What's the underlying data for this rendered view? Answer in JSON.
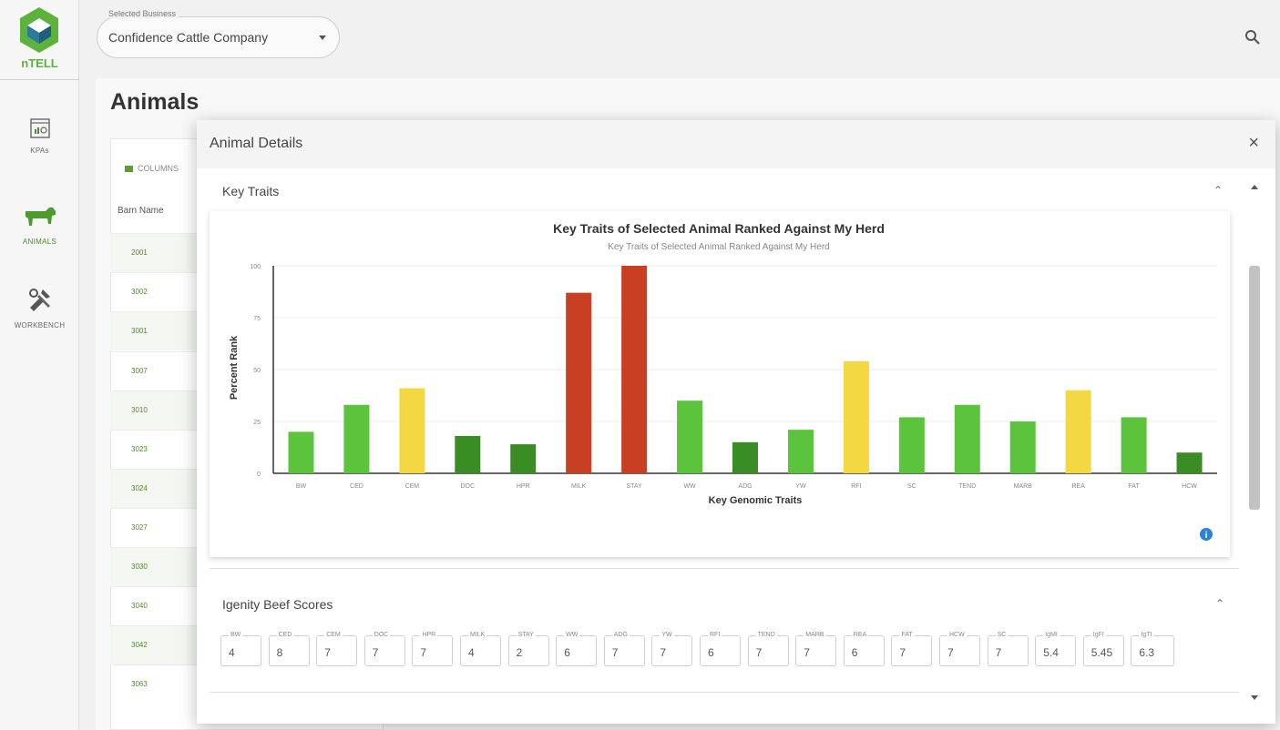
{
  "app": {
    "logo_text": "nTELL"
  },
  "sidebar": {
    "items": [
      {
        "label": "KPAs",
        "icon": "dashboard-icon"
      },
      {
        "label": "ANIMALS",
        "icon": "cow-icon"
      },
      {
        "label": "WORKBENCH",
        "icon": "tools-icon"
      }
    ]
  },
  "business_select": {
    "legend": "Selected Business",
    "value": "Confidence Cattle Company"
  },
  "page": {
    "title": "Animals"
  },
  "table": {
    "columns_label": "COLUMNS",
    "header": "Barn Name",
    "rows": [
      "2001",
      "3002",
      "3001",
      "3007",
      "3010",
      "3023",
      "3024",
      "3027",
      "3030",
      "3040",
      "3042",
      "3063"
    ]
  },
  "modal": {
    "title": "Animal Details",
    "close_label": "×",
    "key_traits_title": "Key Traits",
    "igenity_title": "Igenity Beef Scores"
  },
  "chart_data": {
    "type": "bar",
    "title": "Key Traits of Selected Animal Ranked Against My Herd",
    "subtitle": "Key Traits of Selected Animal Ranked Against My Herd",
    "xlabel": "Key Genomic Traits",
    "ylabel": "Percent Rank",
    "ylim": [
      0,
      100
    ],
    "yticks": [
      0,
      25,
      50,
      75,
      100
    ],
    "grid": true,
    "categories": [
      "BW",
      "CED",
      "CEM",
      "DOC",
      "HPR",
      "MILK",
      "STAY",
      "WW",
      "ADG",
      "YW",
      "RFI",
      "SC",
      "TEND",
      "MARB",
      "REA",
      "FAT",
      "HCW"
    ],
    "values": [
      20,
      33,
      41,
      18,
      14,
      87,
      100,
      35,
      15,
      21,
      54,
      27,
      33,
      25,
      40,
      27,
      10
    ],
    "colors": [
      "#5cc43c",
      "#5cc43c",
      "#f3d843",
      "#3a8c24",
      "#3a8c24",
      "#c93f23",
      "#c93f23",
      "#5cc43c",
      "#3a8c24",
      "#5cc43c",
      "#f3d843",
      "#5cc43c",
      "#5cc43c",
      "#5cc43c",
      "#f3d843",
      "#5cc43c",
      "#3a8c24"
    ]
  },
  "igenity_scores": [
    {
      "label": "BW",
      "value": "4"
    },
    {
      "label": "CED",
      "value": "8"
    },
    {
      "label": "CEM",
      "value": "7"
    },
    {
      "label": "DOC",
      "value": "7"
    },
    {
      "label": "HPR",
      "value": "7"
    },
    {
      "label": "MILK",
      "value": "4"
    },
    {
      "label": "STAY",
      "value": "2"
    },
    {
      "label": "WW",
      "value": "6"
    },
    {
      "label": "ADG",
      "value": "7"
    },
    {
      "label": "YW",
      "value": "7"
    },
    {
      "label": "RFI",
      "value": "6"
    },
    {
      "label": "TEND",
      "value": "7"
    },
    {
      "label": "MARB",
      "value": "7"
    },
    {
      "label": "REA",
      "value": "6"
    },
    {
      "label": "FAT",
      "value": "7"
    },
    {
      "label": "HCW",
      "value": "7"
    },
    {
      "label": "SC",
      "value": "7"
    },
    {
      "label": "IgMI",
      "value": "5.4"
    },
    {
      "label": "IgFI",
      "value": "5.45"
    },
    {
      "label": "IgTI",
      "value": "6.3"
    }
  ],
  "colors": {
    "accent": "#5cb23c",
    "info": "#2b84d6"
  }
}
